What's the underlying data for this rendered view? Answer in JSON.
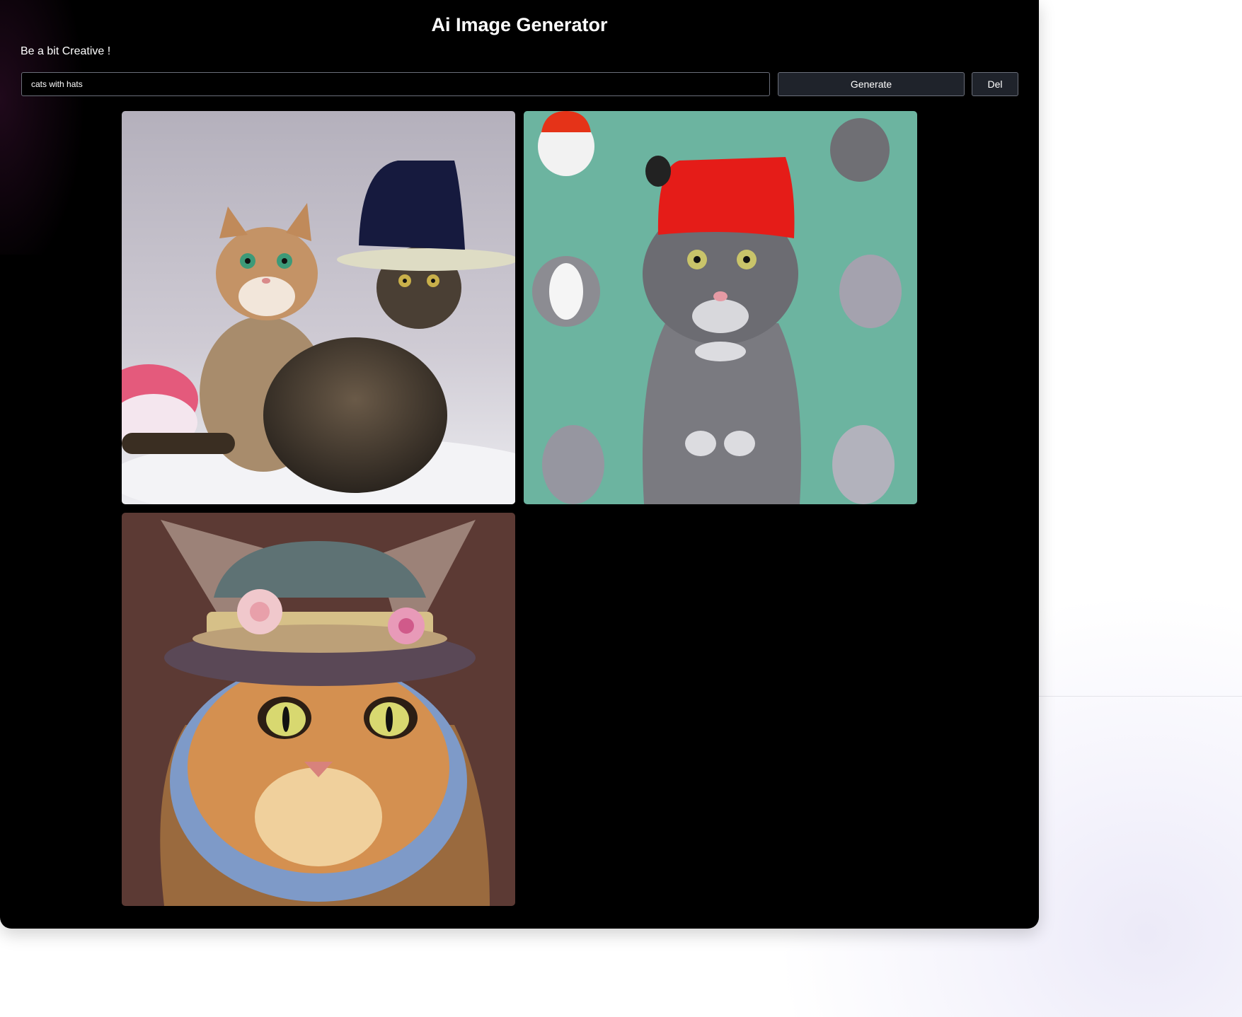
{
  "app": {
    "title": "Ai Image Generator",
    "subtitle": "Be a bit Creative !"
  },
  "prompt": {
    "value": "cats with hats"
  },
  "actions": {
    "generate_label": "Generate",
    "delete_label": "Del"
  },
  "gallery": {
    "images": [
      {
        "subject": "two tabby cats, one wearing a navy bucket hat, pink hat in corner, grey studio backdrop"
      },
      {
        "subject": "grey cat wearing red fez-style hat on teal background surrounded by small grey cats"
      },
      {
        "subject": "painted orange tabby cat with brown hat decorated with pink flowers, brown background"
      }
    ]
  },
  "colors": {
    "app_background": "#000000",
    "button_background": "#1f232b",
    "border": "#6b6f7a",
    "text": "#ffffff"
  }
}
